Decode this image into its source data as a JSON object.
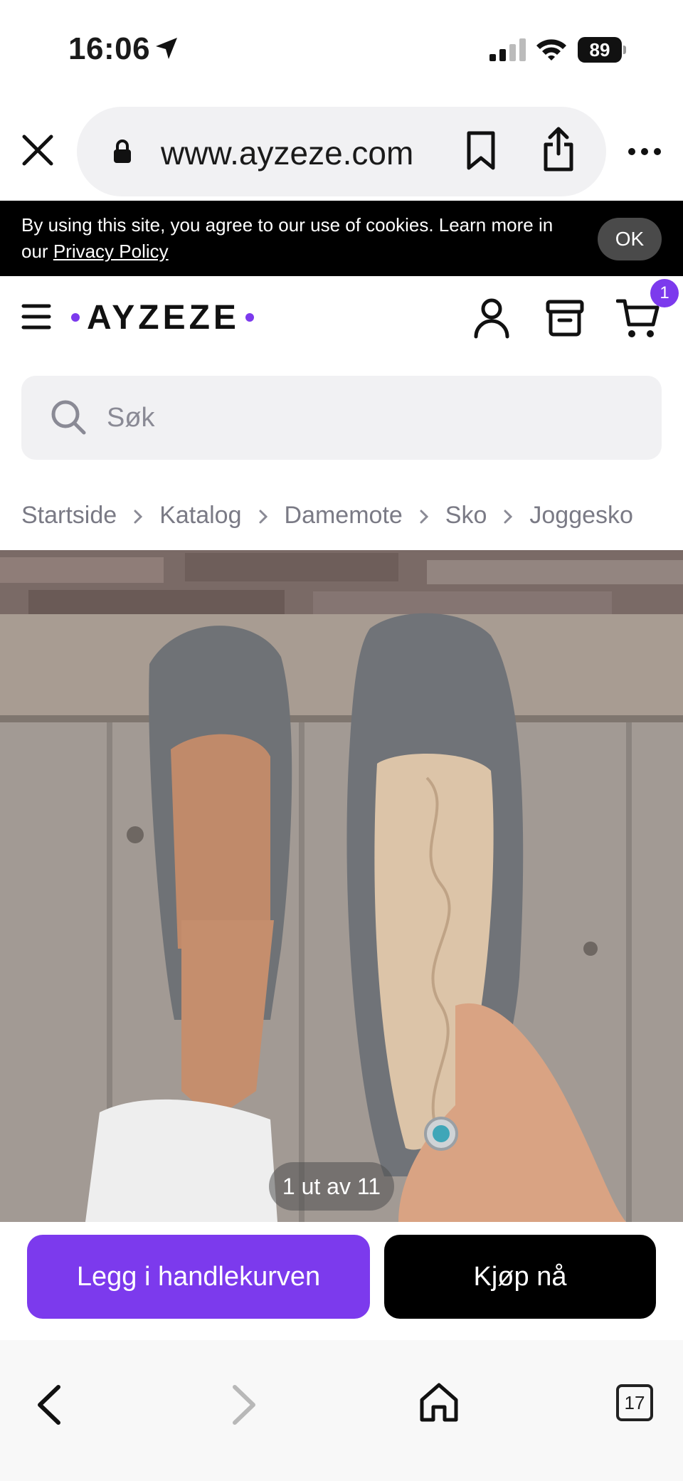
{
  "status_bar": {
    "time": "16:06",
    "battery": "89",
    "icons": [
      "location-arrow-icon",
      "signal-icon",
      "wifi-icon",
      "battery-icon"
    ]
  },
  "browser": {
    "url": "www.ayzeze.com",
    "icons": [
      "close-icon",
      "lock-icon",
      "bookmark-icon",
      "share-icon",
      "more-icon"
    ]
  },
  "cookie_banner": {
    "text": "By using this site, you agree to our use of cookies. Learn more in our ",
    "link": "Privacy Policy",
    "ok_label": "OK"
  },
  "header": {
    "logo": "AYZEZE",
    "cart_count": "1",
    "brand_color": "#7c3aed",
    "icons": [
      "menu-icon",
      "user-icon",
      "orders-icon",
      "cart-icon"
    ]
  },
  "search": {
    "placeholder": "Søk"
  },
  "breadcrumb": [
    "Startside",
    "Katalog",
    "Damemote",
    "Sko",
    "Joggesko"
  ],
  "gallery": {
    "counter": "1 ut av 11"
  },
  "actions": {
    "add_to_cart": "Legg i handlekurven",
    "buy_now": "Kjøp nå"
  },
  "bottom_toolbar": {
    "tabs_count": "17",
    "icons": [
      "back-icon",
      "forward-icon",
      "home-icon",
      "tabs-icon"
    ]
  }
}
